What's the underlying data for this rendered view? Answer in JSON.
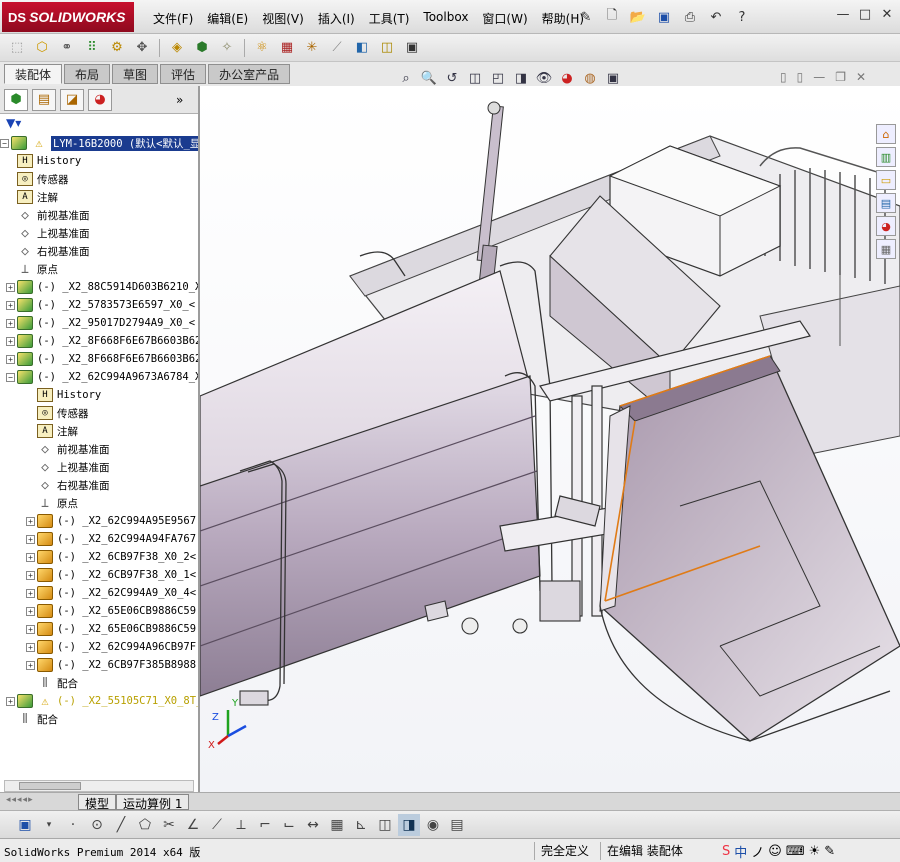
{
  "app": {
    "logo_prefix": "DS",
    "logo": "SOLIDWORKS",
    "menu": [
      "文件(F)",
      "编辑(E)",
      "视图(V)",
      "插入(I)",
      "工具(T)",
      "Toolbox",
      "窗口(W)",
      "帮助(H)"
    ],
    "window_controls": [
      "—",
      "□",
      "✕"
    ]
  },
  "command_tabs": [
    "装配体",
    "布局",
    "草图",
    "评估",
    "办公室产品"
  ],
  "feature_tree": {
    "root_label": "LYM-16B2000 (默认<默认_显",
    "items": [
      {
        "label": "History",
        "icon": "history-icon",
        "indent": 1
      },
      {
        "label": "传感器",
        "icon": "sensor-icon",
        "indent": 1
      },
      {
        "label": "注解",
        "icon": "annotation-icon",
        "indent": 1
      },
      {
        "label": "前视基准面",
        "icon": "plane-icon",
        "indent": 1
      },
      {
        "label": "上视基准面",
        "icon": "plane-icon",
        "indent": 1
      },
      {
        "label": "右视基准面",
        "icon": "plane-icon",
        "indent": 1
      },
      {
        "label": "原点",
        "icon": "origin-icon",
        "indent": 1
      },
      {
        "label": "(-) _X2_88C5914D603B6210_X",
        "icon": "assembly-icon",
        "indent": 1
      },
      {
        "label": "(-) _X2_5783573E6597_X0_<",
        "icon": "assembly-icon",
        "indent": 1
      },
      {
        "label": "(-) _X2_95017D2794A9_X0_<",
        "icon": "assembly-icon",
        "indent": 1
      },
      {
        "label": "(-) _X2_8F668F6E67B6603B62",
        "icon": "assembly-icon",
        "indent": 1
      },
      {
        "label": "(-) _X2_8F668F6E67B6603B62",
        "icon": "assembly-icon",
        "indent": 1
      },
      {
        "label": "(-) _X2_62C994A9673A6784_X",
        "icon": "assembly-icon",
        "indent": 1
      },
      {
        "label": "History",
        "icon": "history-icon",
        "indent": 2
      },
      {
        "label": "传感器",
        "icon": "sensor-icon",
        "indent": 2
      },
      {
        "label": "注解",
        "icon": "annotation-icon",
        "indent": 2
      },
      {
        "label": "前视基准面",
        "icon": "plane-icon",
        "indent": 2
      },
      {
        "label": "上视基准面",
        "icon": "plane-icon",
        "indent": 2
      },
      {
        "label": "右视基准面",
        "icon": "plane-icon",
        "indent": 2
      },
      {
        "label": "原点",
        "icon": "origin-icon",
        "indent": 2
      },
      {
        "label": "(-) _X2_62C994A95E9567",
        "icon": "part-icon",
        "indent": 2
      },
      {
        "label": "(-) _X2_62C994A94FA767",
        "icon": "part-icon",
        "indent": 2
      },
      {
        "label": "(-) _X2_6CB97F38_X0_2<",
        "icon": "part-icon",
        "indent": 2
      },
      {
        "label": "(-) _X2_6CB97F38_X0_1<",
        "icon": "part-icon",
        "indent": 2
      },
      {
        "label": "(-) _X2_62C994A9_X0_4<",
        "icon": "part-icon",
        "indent": 2
      },
      {
        "label": "(-) _X2_65E06CB9886C59",
        "icon": "part-icon",
        "indent": 2
      },
      {
        "label": "(-) _X2_65E06CB9886C59",
        "icon": "part-icon",
        "indent": 2
      },
      {
        "label": "(-) _X2_62C994A96CB97F",
        "icon": "part-icon",
        "indent": 2
      },
      {
        "label": "(-) _X2_6CB97F385B8988",
        "icon": "part-icon",
        "indent": 2
      },
      {
        "label": "配合",
        "icon": "mates-icon",
        "indent": 2
      },
      {
        "label": "(-) _X2_55105C71_X0_8T_",
        "icon": "assembly-icon",
        "indent": 1
      },
      {
        "label": "配合",
        "icon": "mates-icon",
        "indent": 1
      }
    ]
  },
  "bottom_tabs": [
    "模型",
    "运动算例 1"
  ],
  "status": {
    "app_version": "SolidWorks Premium 2014 x64 版",
    "definition": "完全定义",
    "mode": "在编辑 装配体"
  },
  "axis_labels": {
    "x": "X",
    "y": "Y",
    "z": "Z"
  }
}
